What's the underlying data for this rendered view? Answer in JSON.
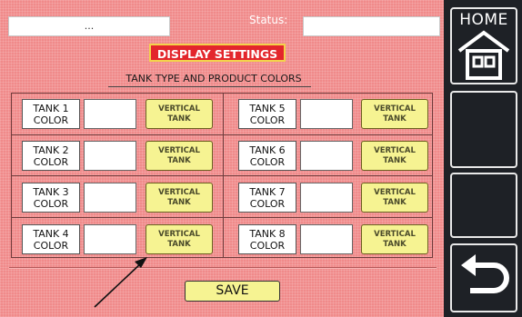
{
  "header": {
    "left_field_value": "...",
    "status_label": "Status:",
    "status_value": ""
  },
  "title": "DISPLAY SETTINGS",
  "subtitle": "TANK TYPE AND PRODUCT COLORS",
  "tanks": [
    {
      "label_line1": "TANK 1",
      "label_line2": "COLOR",
      "type_line1": "VERTICAL",
      "type_line2": "TANK"
    },
    {
      "label_line1": "TANK 2",
      "label_line2": "COLOR",
      "type_line1": "VERTICAL",
      "type_line2": "TANK"
    },
    {
      "label_line1": "TANK 3",
      "label_line2": "COLOR",
      "type_line1": "VERTICAL",
      "type_line2": "TANK"
    },
    {
      "label_line1": "TANK 4",
      "label_line2": "COLOR",
      "type_line1": "VERTICAL",
      "type_line2": "TANK"
    },
    {
      "label_line1": "TANK 5",
      "label_line2": "COLOR",
      "type_line1": "VERTICAL",
      "type_line2": "TANK"
    },
    {
      "label_line1": "TANK 6",
      "label_line2": "COLOR",
      "type_line1": "VERTICAL",
      "type_line2": "TANK"
    },
    {
      "label_line1": "TANK 7",
      "label_line2": "COLOR",
      "type_line1": "VERTICAL",
      "type_line2": "TANK"
    },
    {
      "label_line1": "TANK 8",
      "label_line2": "COLOR",
      "type_line1": "VERTICAL",
      "type_line2": "TANK"
    }
  ],
  "save_label": "SAVE",
  "sidebar": {
    "home_label": "HOME",
    "home_icon": "house-icon",
    "back_icon": "return-arrow-icon"
  },
  "colors": {
    "background": "#f08a8a",
    "title_badge": "#e3262c",
    "button_yellow": "#f6f392",
    "sidebar": "#1e2126"
  }
}
